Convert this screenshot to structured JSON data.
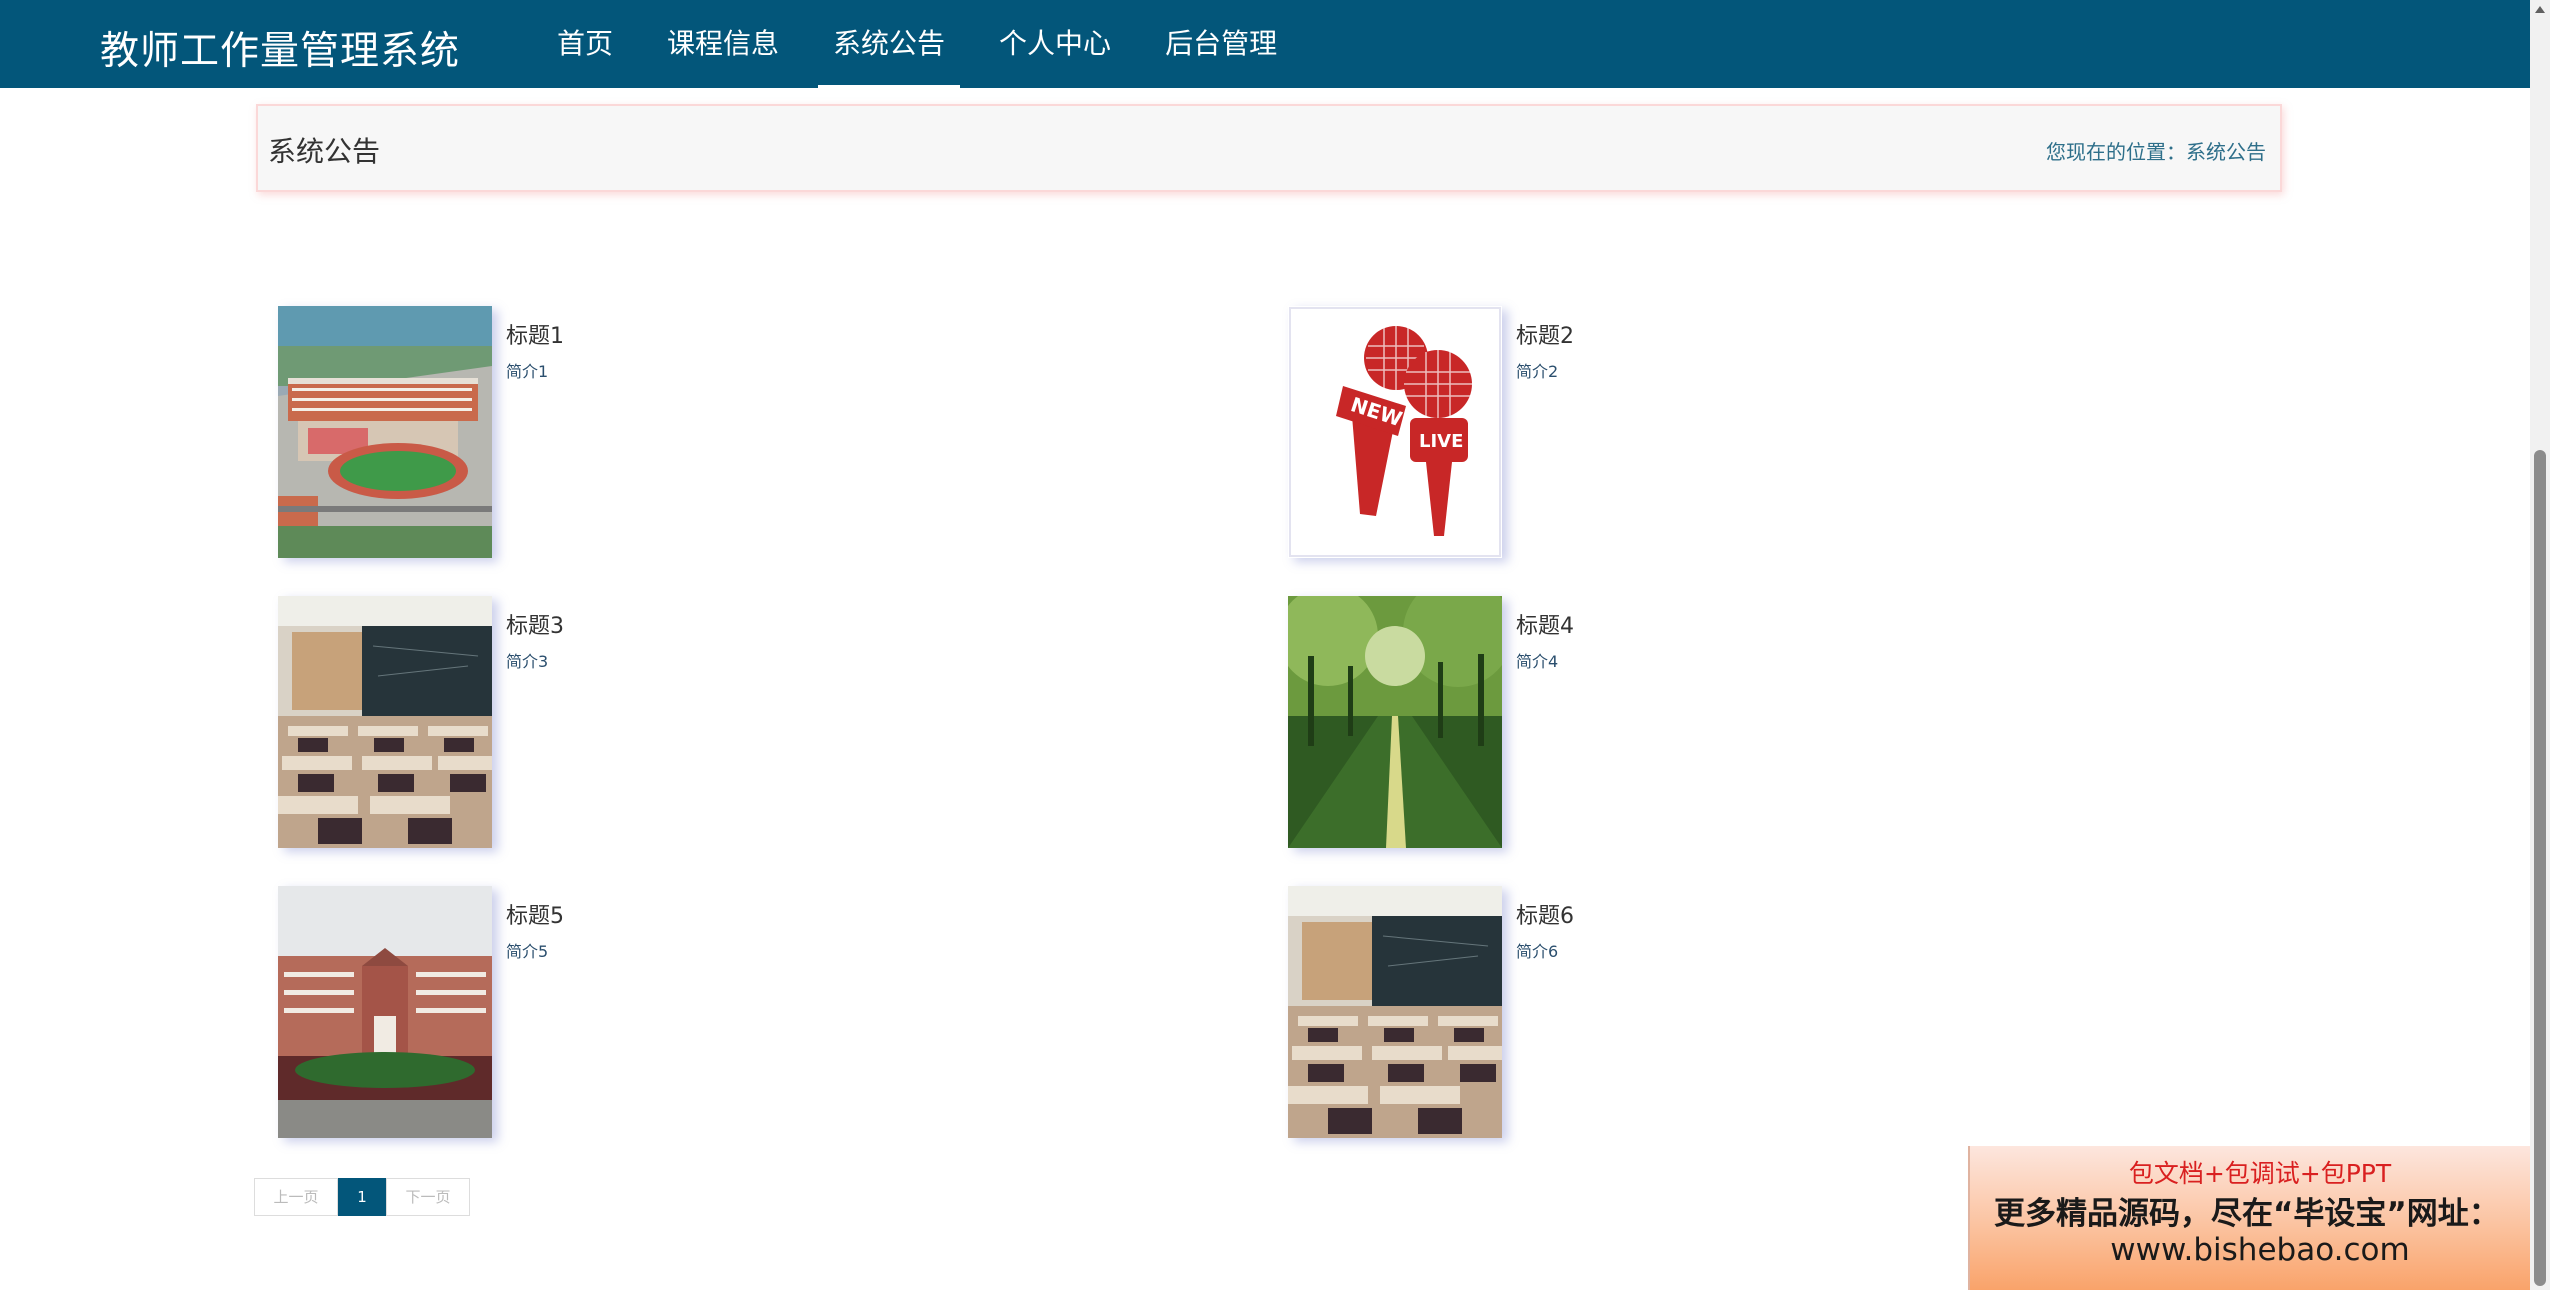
{
  "header": {
    "brand": "教师工作量管理系统",
    "nav": [
      {
        "label": "首页"
      },
      {
        "label": "课程信息"
      },
      {
        "label": "系统公告",
        "active": true
      },
      {
        "label": "个人中心"
      },
      {
        "label": "后台管理"
      }
    ],
    "accent_color": "#03567a"
  },
  "breadcrumb": {
    "title": "系统公告",
    "location": "您现在的位置：系统公告"
  },
  "notices": [
    {
      "title": "标题1",
      "summary": "简介1",
      "image": "school-campus-aerial"
    },
    {
      "title": "标题2",
      "summary": "简介2",
      "image": "news-live-microphones"
    },
    {
      "title": "标题3",
      "summary": "简介3",
      "image": "classroom-desks"
    },
    {
      "title": "标题4",
      "summary": "简介4",
      "image": "tree-lined-path"
    },
    {
      "title": "标题5",
      "summary": "简介5",
      "image": "school-building"
    },
    {
      "title": "标题6",
      "summary": "简介6",
      "image": "classroom-desks"
    }
  ],
  "pagination": {
    "prev": "上一页",
    "current": "1",
    "next": "下一页"
  },
  "ad": {
    "line1": "包文档+包调试+包PPT",
    "line2": "更多精品源码，尽在“毕设宝”网址：",
    "line3": "www.bishebao.com"
  }
}
